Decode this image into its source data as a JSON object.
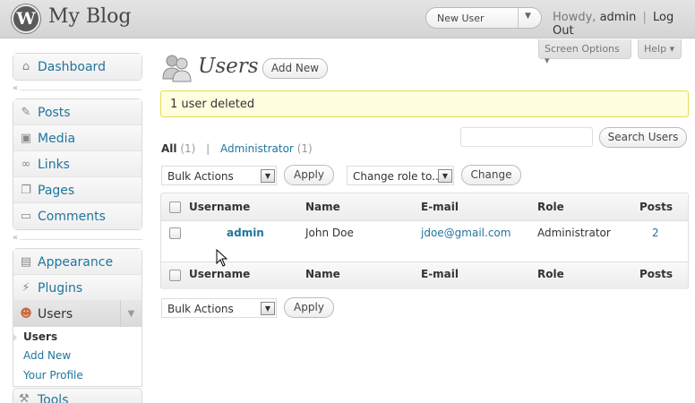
{
  "header": {
    "logo": "W",
    "site_title": "My Blog",
    "favorite_action": "New User",
    "howdy_prefix": "Howdy,",
    "username": "admin",
    "separator": "|",
    "logout": "Log Out"
  },
  "screen_meta": {
    "screen_options": "Screen Options ▾",
    "help": "Help ▾"
  },
  "menu": {
    "group1": [
      {
        "label": "Dashboard",
        "icon": "dashboard-icon"
      }
    ],
    "group2": [
      {
        "label": "Posts",
        "icon": "pin-icon"
      },
      {
        "label": "Media",
        "icon": "media-icon"
      },
      {
        "label": "Links",
        "icon": "link-icon"
      },
      {
        "label": "Pages",
        "icon": "pages-icon"
      },
      {
        "label": "Comments",
        "icon": "comment-icon"
      }
    ],
    "group3": [
      {
        "label": "Appearance",
        "icon": "appearance-icon"
      },
      {
        "label": "Plugins",
        "icon": "plugin-icon"
      },
      {
        "label": "Users",
        "icon": "users-icon"
      }
    ],
    "submenu": [
      "Users",
      "Add New",
      "Your Profile"
    ],
    "tools": "Tools",
    "collapse_glyph": "«"
  },
  "page": {
    "title": "Users",
    "add_new": "Add New",
    "notice": "1 user deleted",
    "views": {
      "all": "All",
      "all_count": "(1)",
      "admin": "Administrator",
      "admin_count": "(1)",
      "separator": "|"
    },
    "search_button": "Search Users",
    "bulk_actions": "Bulk Actions",
    "apply": "Apply",
    "change_role": "Change role to...",
    "change": "Change"
  },
  "table": {
    "columns": [
      "Username",
      "Name",
      "E-mail",
      "Role",
      "Posts"
    ],
    "rows": [
      {
        "username": "admin",
        "name": "John Doe",
        "email": "jdoe@gmail.com",
        "role": "Administrator",
        "posts": "2"
      }
    ]
  },
  "colors": {
    "link": "#21759b",
    "notice_bg": "#ffffe0",
    "notice_border": "#e6db55"
  }
}
